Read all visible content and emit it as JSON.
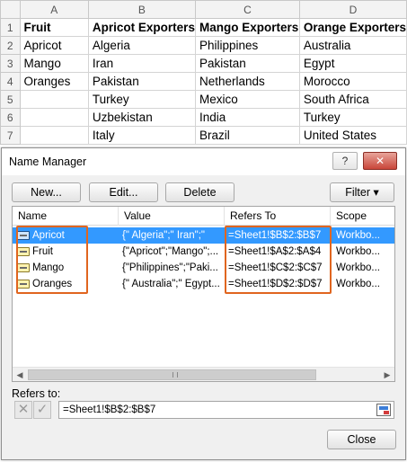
{
  "sheet": {
    "col_headers": [
      "A",
      "B",
      "C",
      "D"
    ],
    "row_headers": [
      "1",
      "2",
      "3",
      "4",
      "5",
      "6",
      "7"
    ],
    "rows": [
      [
        "Fruit",
        "Apricot Exporters",
        "Mango Exporters",
        "Orange Exporters"
      ],
      [
        "Apricot",
        "Algeria",
        "Philippines",
        "Australia"
      ],
      [
        "Mango",
        "Iran",
        "Pakistan",
        "Egypt"
      ],
      [
        "Oranges",
        "Pakistan",
        "Netherlands",
        "Morocco"
      ],
      [
        "",
        "Turkey",
        "Mexico",
        "South Africa"
      ],
      [
        "",
        "Uzbekistan",
        "India",
        "Turkey"
      ],
      [
        "",
        "Italy",
        "Brazil",
        "United States"
      ]
    ]
  },
  "dialog": {
    "title": "Name Manager",
    "help_label": "?",
    "close_x_label": "✕",
    "buttons": {
      "new": "New...",
      "edit": "Edit...",
      "delete": "Delete",
      "filter": "Filter ▾",
      "close": "Close"
    },
    "columns": [
      "Name",
      "Value",
      "Refers To",
      "Scope"
    ],
    "names": [
      {
        "name": "Apricot",
        "value": "{\" Algeria\";\" Iran\";\"",
        "refers_to": "=Sheet1!$B$2:$B$7",
        "scope": "Workbo...",
        "selected": true
      },
      {
        "name": "Fruit",
        "value": "{\"Apricot\";\"Mango\";...",
        "refers_to": "=Sheet1!$A$2:$A$4",
        "scope": "Workbo...",
        "selected": false
      },
      {
        "name": "Mango",
        "value": "{\"Philippines\";\"Paki...",
        "refers_to": "=Sheet1!$C$2:$C$7",
        "scope": "Workbo...",
        "selected": false
      },
      {
        "name": "Oranges",
        "value": "{\" Australia\";\" Egypt...",
        "refers_to": "=Sheet1!$D$2:$D$7",
        "scope": "Workbo...",
        "selected": false
      }
    ],
    "refers_to_label": "Refers to:",
    "refers_to_value": "=Sheet1!$B$2:$B$7",
    "icons": {
      "cancel": "cancel-icon",
      "confirm": "checkmark-icon",
      "collapse": "collapse-dialog-icon"
    },
    "highlight_color": "#e0651f",
    "selection_color": "#3399ff"
  }
}
